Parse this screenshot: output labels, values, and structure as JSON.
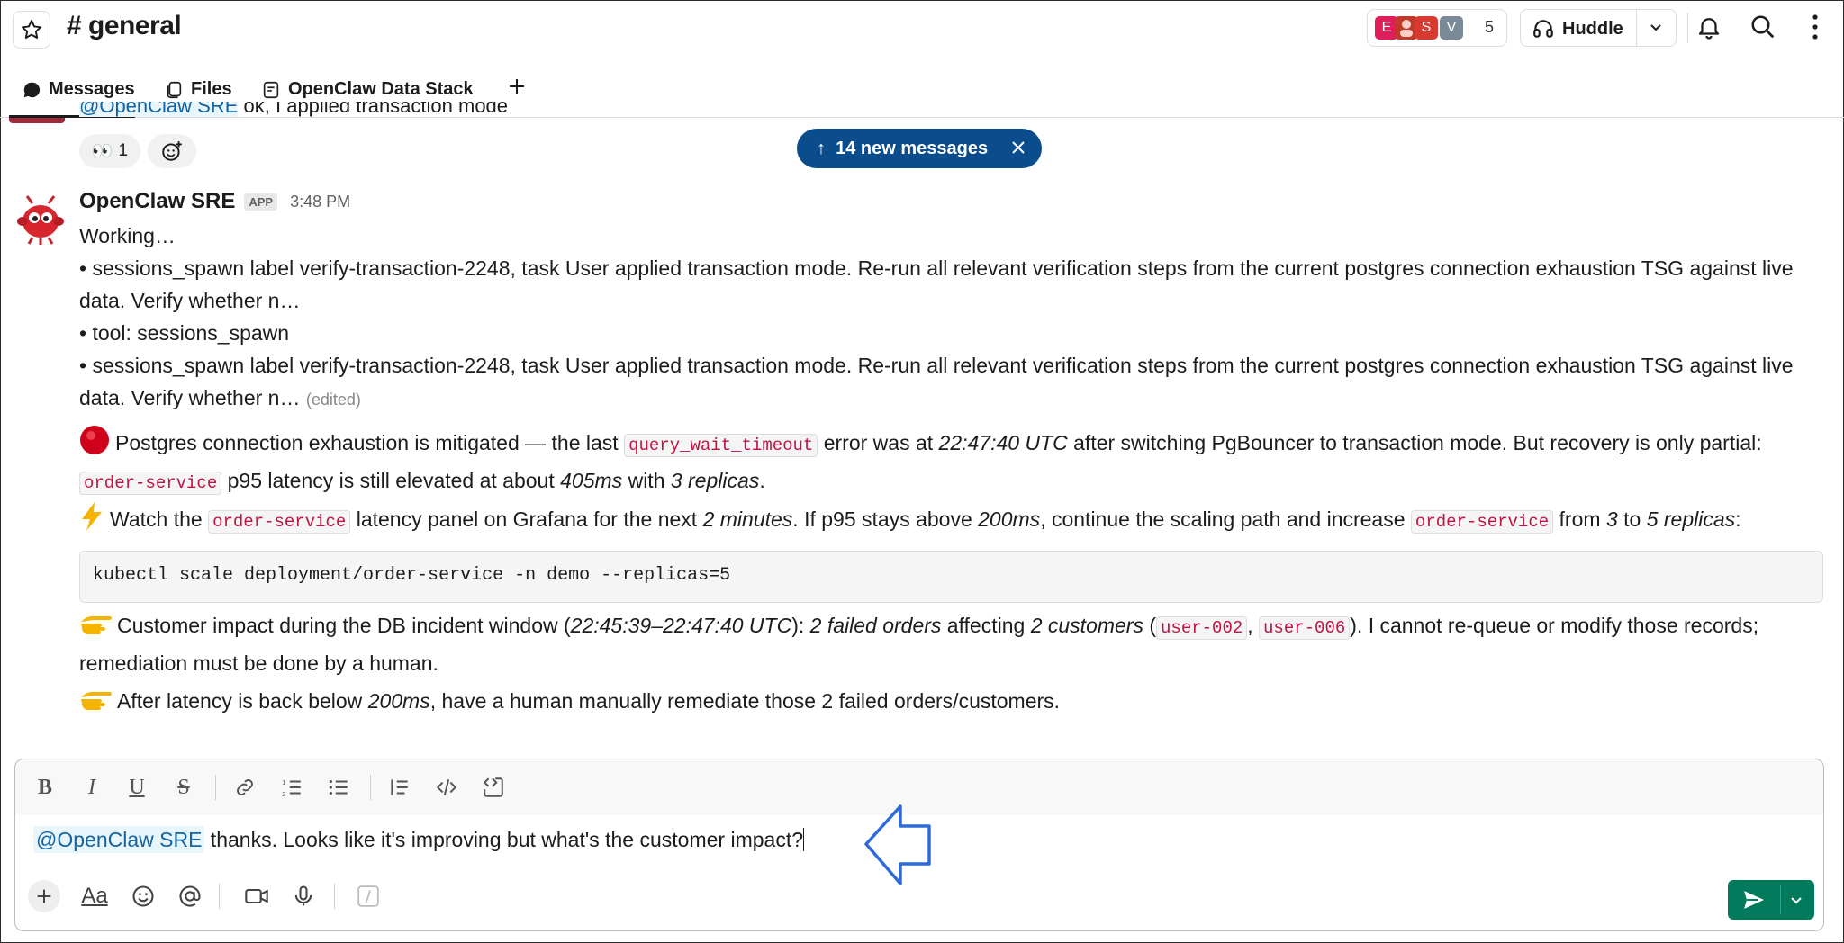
{
  "header": {
    "channel_title": "# general",
    "member_count": "5",
    "member_avatars": [
      {
        "letter": "E",
        "color": "#e01e5a"
      },
      {
        "letter": "",
        "color": "#c0392b"
      },
      {
        "letter": "S",
        "color": "#d93a2f"
      },
      {
        "letter": "V",
        "color": "#7a8a99"
      }
    ],
    "huddle_label": "Huddle"
  },
  "tabs": [
    {
      "label": "Messages",
      "icon": "chat-bubble-icon"
    },
    {
      "label": "Files",
      "icon": "files-icon"
    },
    {
      "label": "OpenClaw Data Stack",
      "icon": "canvas-icon"
    }
  ],
  "previous_message": {
    "mention": "@OpenClaw SRE",
    "text": " ok, I applied transaction mode",
    "reaction_emoji": "👀",
    "reaction_count": "1"
  },
  "new_messages_pill": "14 new messages",
  "message": {
    "sender": "OpenClaw SRE",
    "badge": "APP",
    "time": "3:48 PM",
    "line_working": "Working…",
    "bullet1": "• sessions_spawn label verify-transaction-2248, task User applied transaction mode. Re-run all relevant verification steps from the current postgres connection exhaustion TSG against live data. Verify whether n…",
    "bullet2": "• tool: sessions_spawn",
    "bullet3": "• sessions_spawn label verify-transaction-2248, task User applied transaction mode. Re-run all relevant verification steps from the current postgres connection exhaustion TSG against live data. Verify whether n…",
    "edited": "(edited)",
    "p1": {
      "a": "Postgres connection exhaustion is mitigated — the last ",
      "code1": "query_wait_timeout",
      "b": " error was at ",
      "time": "22:47:40 UTC",
      "c": " after switching PgBouncer to transaction mode. But recovery is only partial: ",
      "code2": "order-service",
      "d": " p95 latency is still elevated at about ",
      "latency": "405ms",
      "e": " with ",
      "replicas": "3 replicas",
      "f": "."
    },
    "p2": {
      "a": "Watch the ",
      "code1": "order-service",
      "b": " latency panel on Grafana for the next ",
      "minutes": "2 minutes",
      "c": ". If p95 stays above ",
      "threshold": "200ms",
      "d": ", continue the scaling path and increase ",
      "code2": "order-service",
      "e": " from ",
      "from": "3",
      "f": " to ",
      "to": "5 replicas",
      "g": ":"
    },
    "code_block": "kubectl scale deployment/order-service -n demo --replicas=5",
    "p3": {
      "a": "Customer impact during the DB incident window (",
      "window": "22:45:39–22:47:40 UTC",
      "b": "): ",
      "orders": "2 failed orders",
      "c": " affecting ",
      "customers": "2 customers",
      "d": " (",
      "code1": "user-002",
      "e": ", ",
      "code2": "user-006",
      "f": "). I cannot re-queue or modify those records; remediation must be done by a human."
    },
    "p4": {
      "a": "After latency is back below ",
      "threshold": "200ms",
      "b": ", have a human manually remediate those 2 failed orders/customers."
    }
  },
  "composer": {
    "mention": "@OpenClaw SRE",
    "text": " thanks. Looks like it's improving but what's the customer impact?",
    "format_buttons": [
      "bold",
      "italic",
      "underline",
      "strikethrough",
      "link",
      "ordered-list",
      "bulleted-list",
      "blockquote",
      "code",
      "code-block"
    ]
  }
}
